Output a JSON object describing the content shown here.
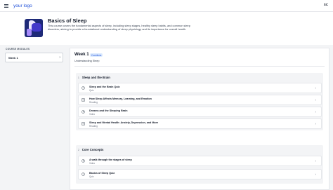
{
  "header": {
    "logo_text": "your logo",
    "user_initials": "SC"
  },
  "course": {
    "title": "Basics of Sleep",
    "description": "This course covers the fundamental aspects of sleep, including sleep stages, healthy sleep habits, and common sleep disorders, aiming to provide a foundational understanding of sleep physiology and its importance for overall health."
  },
  "sidebar": {
    "heading": "COURSE MODULES",
    "modules": [
      {
        "label": "Week 1"
      }
    ]
  },
  "main": {
    "week_title": "Week 1",
    "week_badge": "2 sections",
    "week_subtitle": "Understanding Sleep",
    "sections": [
      {
        "number": "1",
        "title": "Sleep and the Brain",
        "lessons": [
          {
            "title": "Sleep and the Brain Quiz",
            "type": "Quiz",
            "icon": "quiz-icon"
          },
          {
            "title": "How Sleep Affects Memory, Learning, and Emotion",
            "type": "Reading",
            "icon": "reading-icon"
          },
          {
            "title": "Dreams and the Sleeping Brain",
            "type": "Video",
            "icon": "video-icon"
          },
          {
            "title": "Sleep and Mental Health: Anxiety, Depression, and More",
            "type": "Reading",
            "icon": "reading-icon"
          }
        ]
      },
      {
        "number": "2",
        "title": "Core Concepts",
        "lessons": [
          {
            "title": "A walk through the stages of sleep",
            "type": "Video",
            "icon": "video-icon"
          },
          {
            "title": "Basics of Sleep Quiz",
            "type": "Quiz",
            "icon": "quiz-icon"
          }
        ]
      }
    ]
  },
  "colors": {
    "accent": "#1d4ed8",
    "badge_bg": "#dbeafe",
    "cover_bg": "#1e2a78"
  }
}
